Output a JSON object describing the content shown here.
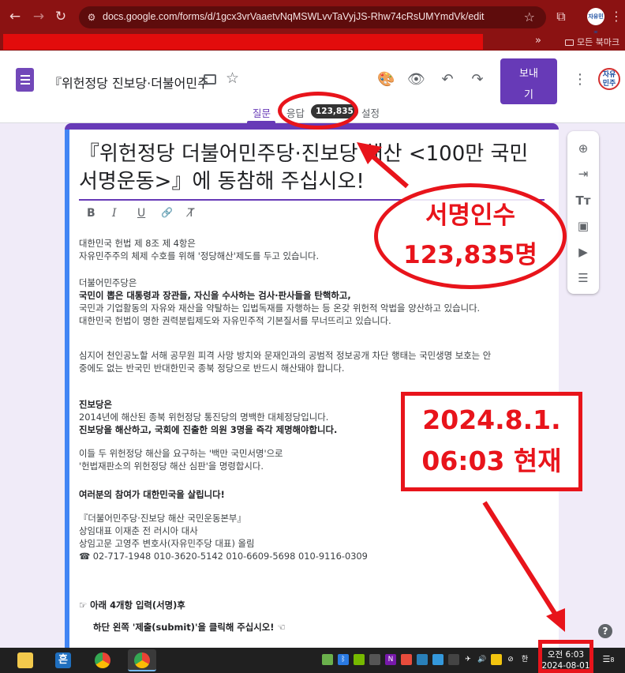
{
  "browser": {
    "url": "docs.google.com/forms/d/1gcx3vrVaaetvNqMSWLvvTaVyjJS-Rhw74cRsUMYmdVk/edit",
    "bookmarks_folder": "모든 북마크",
    "bookmarks_more": "»",
    "profile_label": "자유민주"
  },
  "forms": {
    "doc_title": "『위헌정당 진보당·더불어민주",
    "send_label_1": "보내",
    "send_label_2": "기",
    "party_logo_text_1": "자유",
    "party_logo_text_2": "민주",
    "tabs": {
      "questions": "질문",
      "responses": "응답",
      "response_count": "123,835",
      "settings": "설정"
    }
  },
  "form": {
    "heading_line1": "『위헌정당 더불어민주당·진보당 해산 <100만 국민",
    "heading_line2": "서명운동>』에 동참해 주십시오!",
    "fmt": {
      "bold": "B",
      "italic": "I",
      "underline": "U",
      "link": "🔗",
      "clear": "T̸"
    },
    "p1_l1": "대한민국 헌법 제 8조 제 4항은",
    "p1_l2": "자유민주주의 체제 수호를 위해 '정당해산'제도를 두고 있습니다.",
    "p2_l1": "더불어민주당은",
    "p2_l2": "국민이 뽑은 대통령과 장관들, 자신을 수사하는 검사·판사들을 탄핵하고,",
    "p2_l3": "국민과 기업활동의 자유와 재산을 약탈하는 입법독재를 자행하는 등 온갖 위헌적 악법을 양산하고 있습니다.",
    "p2_l4": "대한민국 헌법이 명한 권력분립제도와 자유민주적 기본질서를 무너뜨리고 있습니다.",
    "p3_l1": "심지어 천인공노할 서해 공무원 피격 사망 방치와 문재인과의 공범적 정보공개 차단 행태는 국민생명 보호는 안",
    "p3_l2": "중에도 없는 반국민 반대한민국 종북 정당으로 반드시 해산돼야 합니다.",
    "p4_l1": "진보당은",
    "p4_l2": "2014년에 해산된 종북 위헌정당 통진당의 명백한 대체정당입니다.",
    "p4_l3": "진보당을 해산하고, 국회에 진출한 의원 3명을 즉각 제명해야합니다.",
    "p5_l1": "이들 두 위헌정당 해산을 요구하는 '백만 국민서명'으로",
    "p5_l2": "'헌법재판소의 위헌정당 해산 심판'을 명령합시다.",
    "p6": "여러분의 참여가 대한민국을 살립니다!",
    "org": "『더불어민주당·진보당 해산 국민운동본부』",
    "rep": "상임대표 이재춘 전 러시아 대사",
    "advisor": "상임고문 고영주 변호사(자유민주당 대표) 올림",
    "phones": "☎ 02-717-1948  010-3620-5142  010-6609-5698  010-9116-0309",
    "instr1": "☞ 아래 4개항 입력(서명)후",
    "instr2": "하단 왼쪽 '제출(submit)'을 클릭해 주십시오! ☜"
  },
  "annotations": {
    "signatures_1": "서명인수",
    "signatures_2": "123,835명",
    "date_1": "2024.8.1.",
    "date_2": "06:03  현재",
    "color": "#e8141b"
  },
  "taskbar": {
    "hangul_app": "흔",
    "clock_time": "오전 6:03",
    "clock_date": "2024-08-01",
    "ime": "한",
    "notification_count": "8"
  },
  "colors": {
    "chrome": "#8b1212",
    "accent": "#673ab7"
  }
}
